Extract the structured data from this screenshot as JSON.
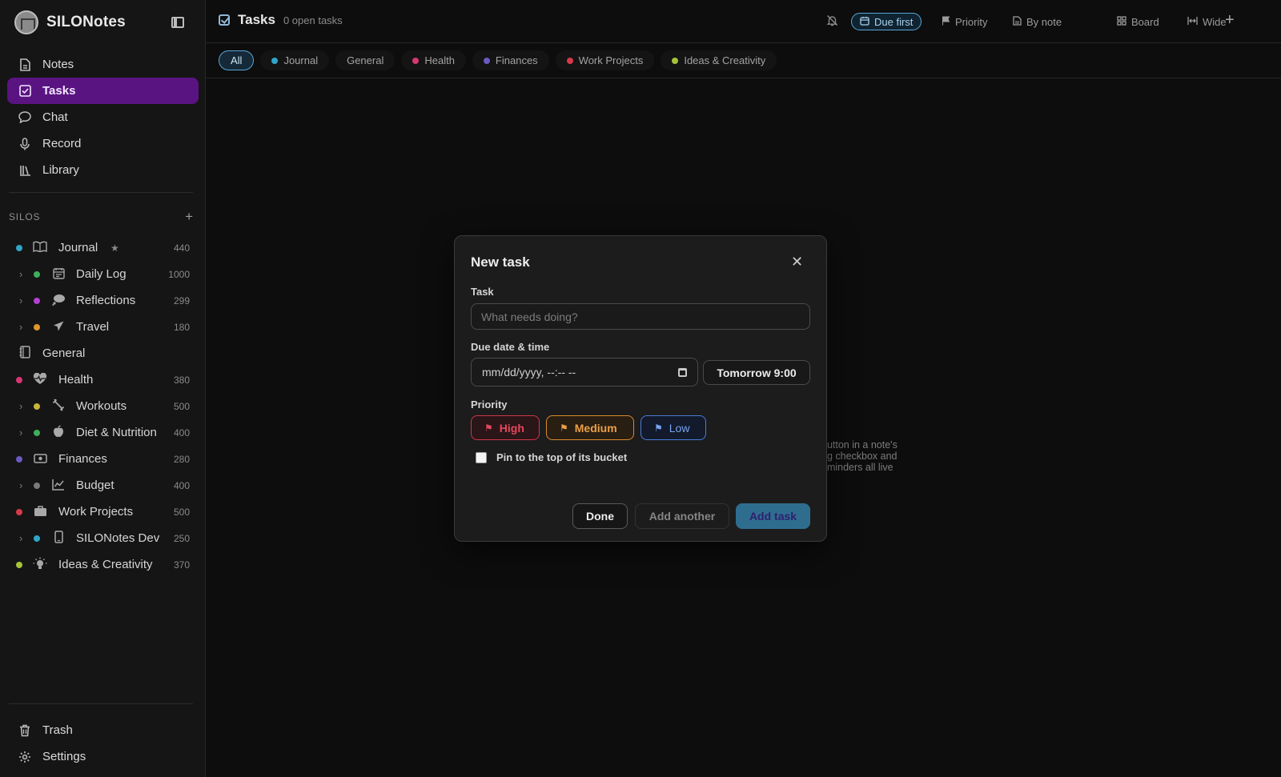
{
  "app": {
    "name": "SILONotes"
  },
  "nav": [
    {
      "id": "notes",
      "label": "Notes",
      "icon": "document-icon"
    },
    {
      "id": "tasks",
      "label": "Tasks",
      "icon": "checkbox-icon",
      "active": true
    },
    {
      "id": "chat",
      "label": "Chat",
      "icon": "chat-bubble-icon"
    },
    {
      "id": "record",
      "label": "Record",
      "icon": "microphone-icon"
    },
    {
      "id": "library",
      "label": "Library",
      "icon": "library-icon"
    }
  ],
  "silos_header": {
    "title": "SILOS",
    "add": "+"
  },
  "silos": [
    {
      "label": "Journal",
      "count": "440",
      "color": "#2fa6c9",
      "icon": "book-icon",
      "level": 0,
      "starred": true
    },
    {
      "label": "Daily Log",
      "count": "1000",
      "color": "#3fae5a",
      "icon": "calendar-icon",
      "level": 1
    },
    {
      "label": "Reflections",
      "count": "299",
      "color": "#b43fd0",
      "icon": "thought-bubble-icon",
      "level": 1
    },
    {
      "label": "Travel",
      "count": "180",
      "color": "#e0962c",
      "icon": "plane-icon",
      "level": 1
    },
    {
      "label": "General",
      "count": "",
      "color": "",
      "icon": "notebook-icon",
      "level": 0
    },
    {
      "label": "Health",
      "count": "380",
      "color": "#d63672",
      "icon": "heart-pulse-icon",
      "level": 0
    },
    {
      "label": "Workouts",
      "count": "500",
      "color": "#c7b43a",
      "icon": "dumbbell-icon",
      "level": 1
    },
    {
      "label": "Diet & Nutrition",
      "count": "400",
      "color": "#3fae5a",
      "icon": "apple-icon",
      "level": 1
    },
    {
      "label": "Finances",
      "count": "280",
      "color": "#6a5ac0",
      "icon": "banknote-icon",
      "level": 0
    },
    {
      "label": "Budget",
      "count": "400",
      "color": "#7a7a7a",
      "icon": "line-chart-icon",
      "level": 1
    },
    {
      "label": "Work Projects",
      "count": "500",
      "color": "#d63a4a",
      "icon": "briefcase-icon",
      "level": 0
    },
    {
      "label": "SILONotes Dev",
      "count": "250",
      "color": "#2fa6c9",
      "icon": "phone-icon",
      "level": 1
    },
    {
      "label": "Ideas & Creativity",
      "count": "370",
      "color": "#a6c23a",
      "icon": "lightbulb-icon",
      "level": 0
    }
  ],
  "bottom_nav": [
    {
      "label": "Trash",
      "icon": "trash-icon"
    },
    {
      "label": "Settings",
      "icon": "gear-icon"
    }
  ],
  "topbar": {
    "title": "Tasks",
    "subtitle": "0 open tasks",
    "sort_due": "Due first",
    "sort_priority": "Priority",
    "sort_note": "By note",
    "view_board": "Board",
    "view_wide": "Wide",
    "add": "+"
  },
  "filters": [
    {
      "label": "All",
      "color": "",
      "active": true
    },
    {
      "label": "Journal",
      "color": "#2fa6c9"
    },
    {
      "label": "General",
      "color": ""
    },
    {
      "label": "Health",
      "color": "#d63672"
    },
    {
      "label": "Finances",
      "color": "#6a5ac0"
    },
    {
      "label": "Work Projects",
      "color": "#d63a4a"
    },
    {
      "label": "Ideas & Creativity",
      "color": "#a6c23a"
    }
  ],
  "hint": {
    "line1": "button in a note's",
    "line2": "ng checkbox and",
    "line3": "eminders all live"
  },
  "modal": {
    "title": "New task",
    "close": "✕",
    "task_label": "Task",
    "task_placeholder": "What needs doing?",
    "due_label": "Due date & time",
    "due_value": "mm/dd/yyyy, --:-- --",
    "tomorrow": "Tomorrow 9:00",
    "priority_label": "Priority",
    "priority_high": "High",
    "priority_medium": "Medium",
    "priority_low": "Low",
    "pin_label": "Pin to the top of its bucket",
    "done": "Done",
    "add_another": "Add another",
    "add_task": "Add task"
  },
  "colors": {
    "accent": "#5a1482",
    "active_chip": "#5aa6d8",
    "high": "#e3485b",
    "medium": "#eba048",
    "low": "#7aa2ee"
  }
}
